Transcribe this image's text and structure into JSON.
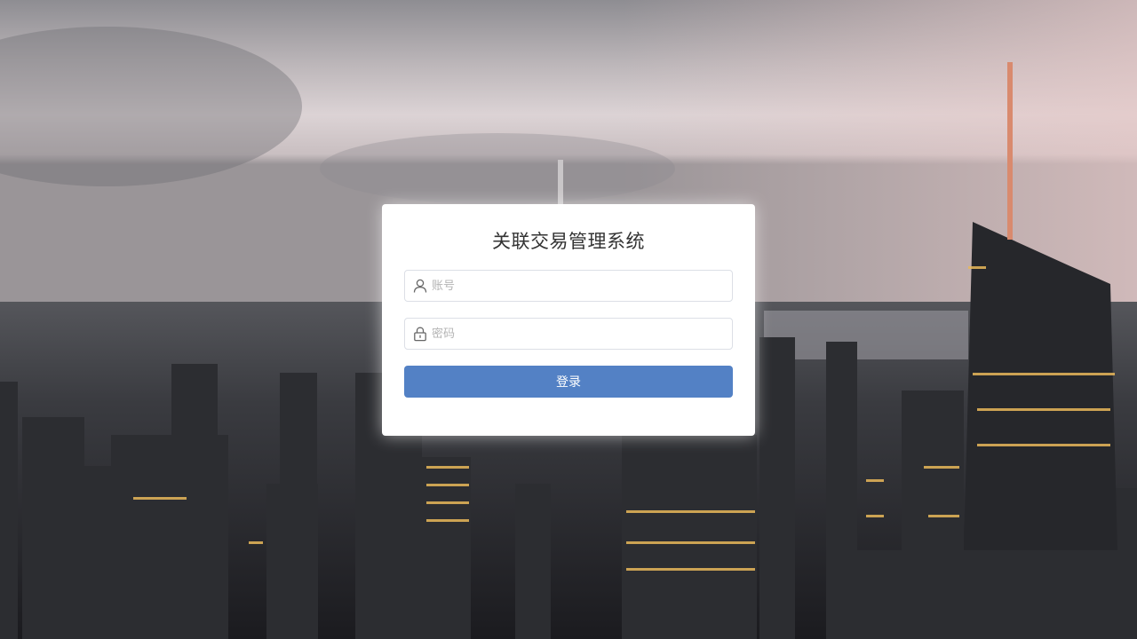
{
  "page": {
    "background": "city-skyline-dusk-photo"
  },
  "login": {
    "title": "关联交易管理系统",
    "account_placeholder": "账号",
    "account_icon": "user-icon",
    "password_placeholder": "密码",
    "password_icon": "lock-icon",
    "submit_label": "登录"
  },
  "colors": {
    "button": "#5381c5",
    "card": "#ffffff",
    "title": "#333333"
  }
}
